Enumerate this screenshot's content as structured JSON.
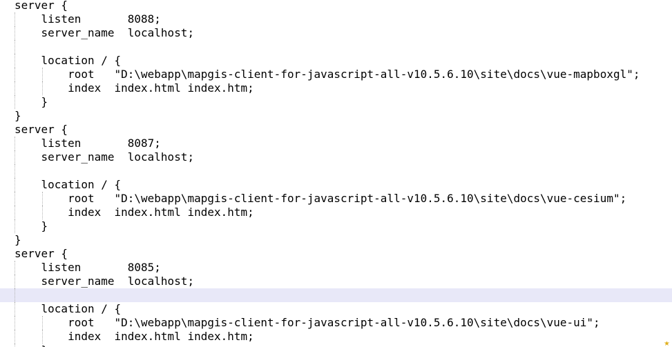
{
  "editor": {
    "lines": [
      {
        "text": "server {",
        "depth": 0
      },
      {
        "text": "    listen       8088;",
        "depth": 1
      },
      {
        "text": "    server_name  localhost;",
        "depth": 1
      },
      {
        "text": "",
        "depth": 1
      },
      {
        "text": "    location / {",
        "depth": 1
      },
      {
        "text": "        root   \"D:\\webapp\\mapgis-client-for-javascript-all-v10.5.6.10\\site\\docs\\vue-mapboxgl\";",
        "depth": 2
      },
      {
        "text": "        index  index.html index.htm;",
        "depth": 2
      },
      {
        "text": "    }",
        "depth": 1
      },
      {
        "text": "}",
        "depth": 0
      },
      {
        "text": "server {",
        "depth": 0
      },
      {
        "text": "    listen       8087;",
        "depth": 1
      },
      {
        "text": "    server_name  localhost;",
        "depth": 1
      },
      {
        "text": "",
        "depth": 1
      },
      {
        "text": "    location / {",
        "depth": 1
      },
      {
        "text": "        root   \"D:\\webapp\\mapgis-client-for-javascript-all-v10.5.6.10\\site\\docs\\vue-cesium\";",
        "depth": 2
      },
      {
        "text": "        index  index.html index.htm;",
        "depth": 2
      },
      {
        "text": "    }",
        "depth": 1
      },
      {
        "text": "}",
        "depth": 0
      },
      {
        "text": "server {",
        "depth": 0
      },
      {
        "text": "    listen       8085;",
        "depth": 1
      },
      {
        "text": "    server_name  localhost;",
        "depth": 1
      },
      {
        "text": "",
        "depth": 1,
        "current": true
      },
      {
        "text": "    location / {",
        "depth": 1
      },
      {
        "text": "        root   \"D:\\webapp\\mapgis-client-for-javascript-all-v10.5.6.10\\site\\docs\\vue-ui\";",
        "depth": 2
      },
      {
        "text": "        index  index.html index.htm;",
        "depth": 2
      },
      {
        "text": "    }",
        "depth": 1
      }
    ],
    "colors": {
      "background": "#ffffff",
      "text": "#000000",
      "current_line": "#e8e8f8",
      "indent_guide": "#b4b4b4"
    },
    "corner_icon": "bookmark-corner-icon"
  }
}
